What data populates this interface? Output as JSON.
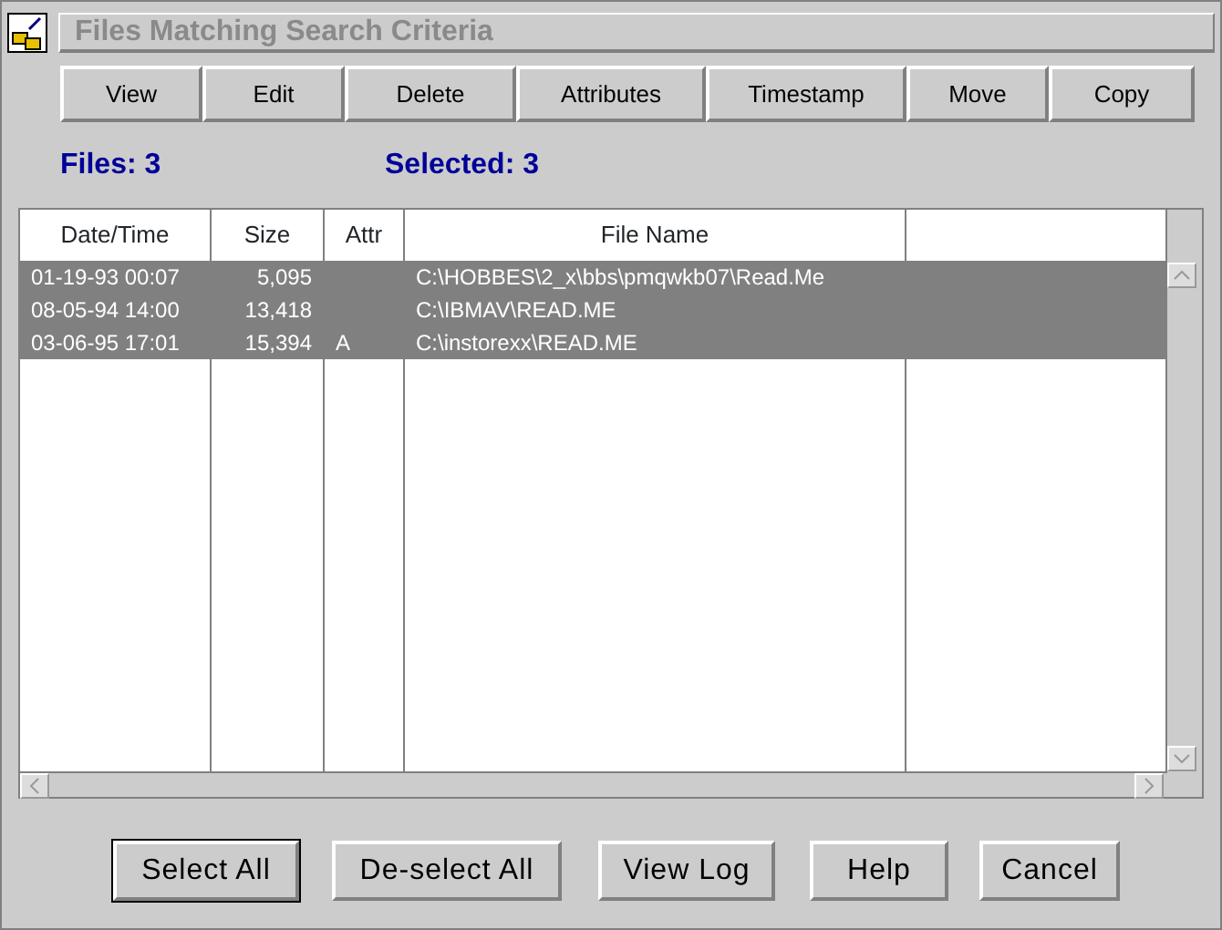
{
  "window": {
    "title": "Files Matching Search Criteria"
  },
  "toolbar": [
    "View",
    "Edit",
    "Delete",
    "Attributes",
    "Timestamp",
    "Move",
    "Copy"
  ],
  "summary": {
    "files": "Files: 3",
    "selected": "Selected: 3"
  },
  "table": {
    "columns": [
      "Date/Time",
      "Size",
      "Attr",
      "File Name"
    ],
    "rows": [
      {
        "cells": [
          "01-19-93 00:07",
          "5,095",
          "",
          "C:\\HOBBES\\2_x\\bbs\\pmqwkb07\\Read.Me"
        ],
        "selected": true
      },
      {
        "cells": [
          "08-05-94 14:00",
          "13,418",
          "",
          "C:\\IBMAV\\READ.ME"
        ],
        "selected": true
      },
      {
        "cells": [
          "03-06-95 17:01",
          "15,394",
          "A",
          "C:\\instorexx\\READ.ME"
        ],
        "selected": true
      }
    ]
  },
  "buttons": [
    {
      "label": "Select All",
      "default": true
    },
    {
      "label": "De-select All",
      "default": false
    },
    {
      "label": "View Log",
      "default": false
    },
    {
      "label": "Help",
      "default": false
    },
    {
      "label": "Cancel",
      "default": false
    }
  ]
}
